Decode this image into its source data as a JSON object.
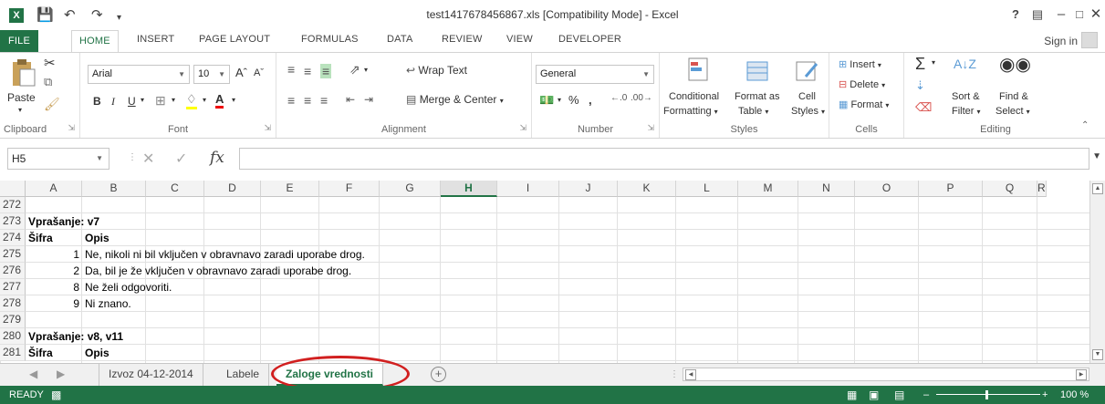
{
  "window": {
    "title": "test1417678456867.xls  [Compatibility Mode] - Excel",
    "help": "?",
    "signin": "Sign in"
  },
  "tabs": [
    "FILE",
    "HOME",
    "INSERT",
    "PAGE LAYOUT",
    "FORMULAS",
    "DATA",
    "REVIEW",
    "VIEW",
    "DEVELOPER"
  ],
  "ribbon": {
    "paste": "Paste",
    "clipboard": "Clipboard",
    "font_name": "Arial",
    "font_size": "10",
    "font_group": "Font",
    "wrap_text": "Wrap Text",
    "merge_center": "Merge & Center",
    "alignment_group": "Alignment",
    "number_format": "General",
    "number_group": "Number",
    "conditional_formatting_1": "Conditional",
    "conditional_formatting_2": "Formatting",
    "format_as_table_1": "Format as",
    "format_as_table_2": "Table",
    "cell_styles_1": "Cell",
    "cell_styles_2": "Styles",
    "styles_group": "Styles",
    "insert": "Insert",
    "delete": "Delete",
    "format": "Format",
    "cells_group": "Cells",
    "sort_filter_1": "Sort &",
    "sort_filter_2": "Filter",
    "find_select_1": "Find &",
    "find_select_2": "Select",
    "editing_group": "Editing",
    "percent": "%",
    "comma": ","
  },
  "formula_bar": {
    "name_box": "H5",
    "fx": "fx",
    "value": ""
  },
  "columns": [
    "A",
    "B",
    "C",
    "D",
    "E",
    "F",
    "G",
    "H",
    "I",
    "J",
    "K",
    "L",
    "M",
    "N",
    "O",
    "P",
    "Q",
    "R"
  ],
  "selected_column": "H",
  "rows": [
    {
      "num": "272",
      "a": "",
      "b": ""
    },
    {
      "num": "273",
      "a": "Vprašanje: v7",
      "b": "",
      "bold": true
    },
    {
      "num": "274",
      "a": "Šifra",
      "b": "Opis",
      "bold": true
    },
    {
      "num": "275",
      "a": "1",
      "b": "Ne, nikoli ni bil vključen v obravnavo zaradi uporabe drog."
    },
    {
      "num": "276",
      "a": "2",
      "b": "Da, bil je že vključen v obravnavo zaradi uporabe drog."
    },
    {
      "num": "277",
      "a": "8",
      "b": "Ne želi odgovoriti."
    },
    {
      "num": "278",
      "a": "9",
      "b": "Ni znano."
    },
    {
      "num": "279",
      "a": "",
      "b": ""
    },
    {
      "num": "280",
      "a": "Vprašanje: v8, v11",
      "b": "",
      "bold": true
    },
    {
      "num": "281",
      "a": "Šifra",
      "b": "Opis",
      "bold": true
    }
  ],
  "sheets": [
    "Izvoz 04-12-2014",
    "Labele",
    "Zaloge vrednosti"
  ],
  "active_sheet": "Zaloge vrednosti",
  "status": {
    "ready": "READY",
    "zoom": "100 %"
  },
  "colors": {
    "accent": "#217346",
    "annotation": "#d11f1f"
  }
}
